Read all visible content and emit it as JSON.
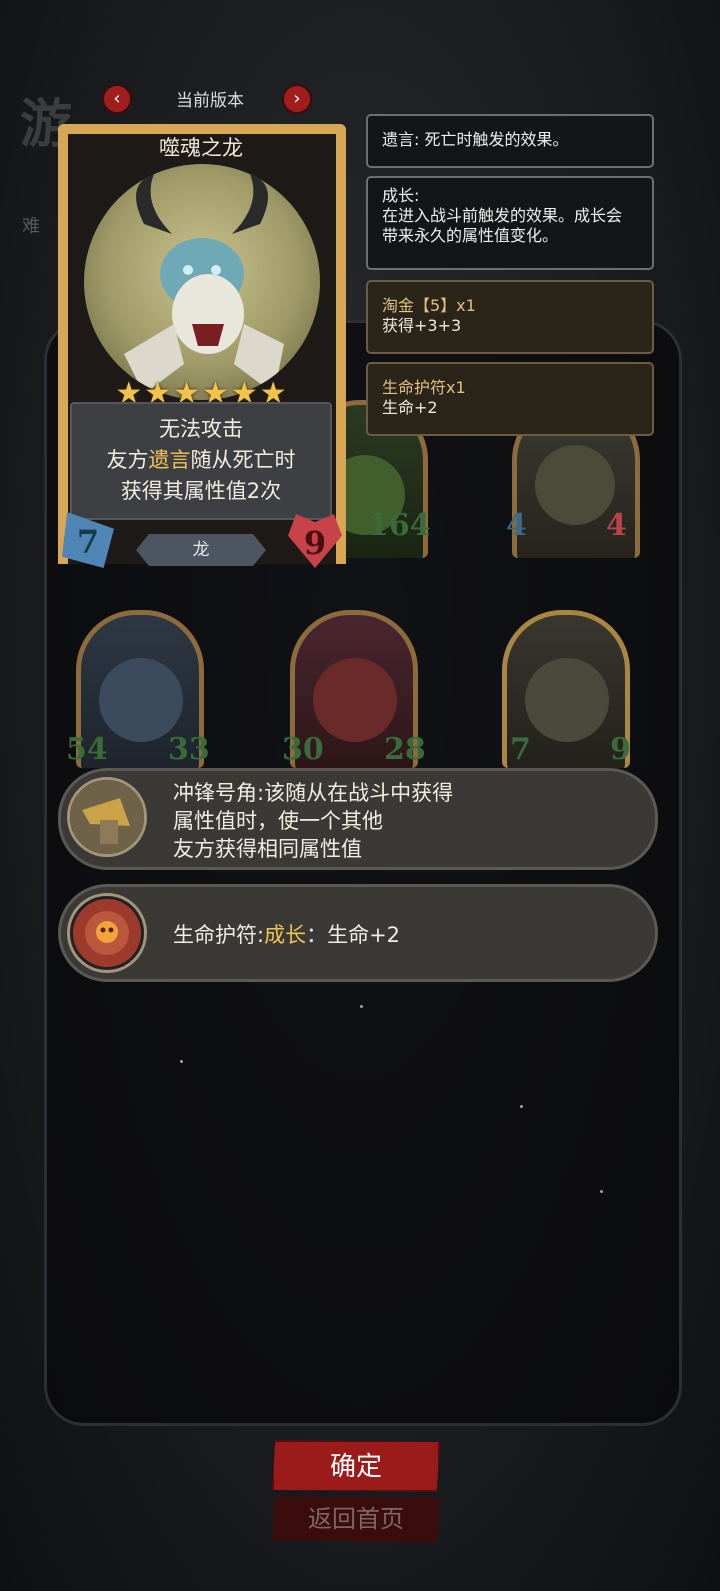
{
  "background": {
    "title_fragment": "游",
    "difficulty_fragment": "难"
  },
  "version_selector": {
    "label": "当前版本",
    "prev_icon": "chevron-left-icon",
    "next_icon": "chevron-right-icon"
  },
  "card": {
    "name": "噬魂之龙",
    "stars": "★★★★★★",
    "desc_line1": "无法攻击",
    "desc_line2_pre": "友方",
    "desc_line2_kw": "遗言",
    "desc_line2_post": "随从死亡时",
    "desc_line3": "获得其属性值2次",
    "tribe": "龙",
    "attack": "7",
    "health": "9"
  },
  "tooltips": [
    {
      "title": "遗言: 死亡时触发的效果。"
    },
    {
      "title": "成长:",
      "body1": "在进入战斗前触发的效果。成长会",
      "body2": "带来永久的属性值变化。"
    },
    {
      "title": "淘金【5】x1",
      "body1": "获得+3+3"
    },
    {
      "title": "生命护符x1",
      "body1": "生命+2"
    }
  ],
  "minions": [
    {
      "attack": "",
      "health": "164"
    },
    {
      "attack": "4",
      "health": "4"
    },
    {
      "attack": "54",
      "health": "33"
    },
    {
      "attack": "30",
      "health": "28"
    },
    {
      "attack": "7",
      "health": "9"
    }
  ],
  "abilities": [
    {
      "line1": "冲锋号角:该随从在战斗中获得",
      "line2": "属性值时，使一个其他",
      "line3": "友方获得相同属性值"
    },
    {
      "pre": "生命护符:",
      "kw": "成长",
      "post": "：生命+2"
    }
  ],
  "buttons": {
    "confirm": "确定",
    "back": "返回首页"
  },
  "colors": {
    "accent_red": "#9b1b1b",
    "gold": "#f2c454",
    "card_frame": "#d7a755"
  }
}
